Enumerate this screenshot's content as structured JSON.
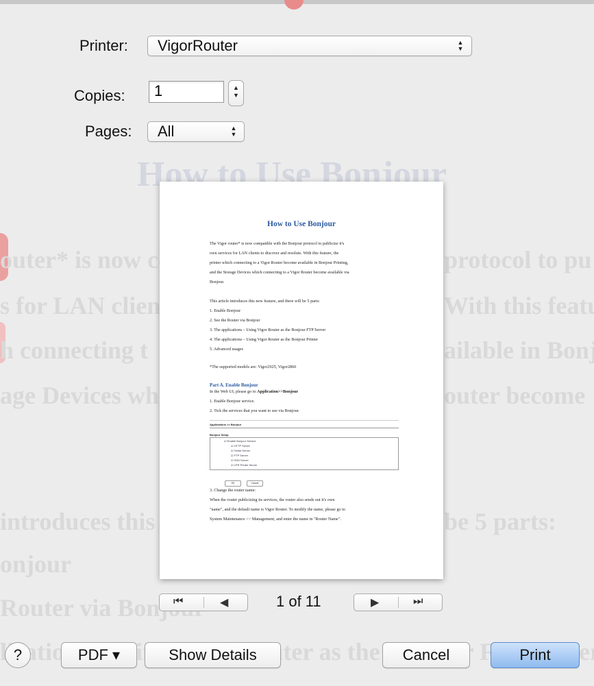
{
  "background_document": {
    "title": "How to Use Bonjour",
    "lines": [
      "outer* is now co",
      "protocol to pu",
      "s for LAN client",
      "With this featu",
      "h connecting t",
      "ailable in Bonj",
      "age Devices wh",
      "outer become",
      "introduces this",
      "be 5 parts:",
      "onjour",
      "Router via Bonjour",
      "lications - Using Vigor Router as the Bonjour FTP Server"
    ]
  },
  "printer": {
    "label": "Printer:",
    "value": "VigorRouter"
  },
  "copies": {
    "label": "Copies:",
    "value": "1"
  },
  "pages": {
    "label": "Pages:",
    "value": "All"
  },
  "preview": {
    "title": "How to Use Bonjour",
    "intro": [
      "The Vigor router* is now compatible with the Bonjour protocol to publicize it's",
      "own services for LAN clients to discover and resolute. With this feature, the",
      "printer which connecting to a Vigor Router become available in Bonjour Printing,",
      "and the Storage Devices which connecting to a Vigor Router become available via",
      "Bonjour."
    ],
    "parts_intro": "This article introduces this new feature, and there will be 5 parts:",
    "parts": [
      "1.   Enable Bonjour",
      "2.   See the Router via Bonjour",
      "3.   The applications – Using Vigor Router as the Bonjour FTP Server",
      "4.   The applications – Using Vigor Router as the Bonjour Printer",
      "5.   Advanced usages"
    ],
    "supported": "*The supported models are: Vigor2925, Vigor2860",
    "part_a_title": "Part A. Enable Bonjour",
    "part_a_lead": "In the Web UI, please go to ",
    "part_a_path": "Application>>Bonjour",
    "part_a_steps": [
      "1.   Enable Bonjour service.",
      "2.   Tick the services that you want to see via Bonjour."
    ],
    "screenshot": {
      "header": "Applications >> Bonjour",
      "section": "Bonjour Setup",
      "items": [
        "☑ Enable Bonjour Service",
        "☑ HTTP Server",
        "☑ Telnet Server",
        "☑ FTP Server",
        "☑ SSH Server",
        "☑ LPR Printer Server"
      ],
      "ok": "OK",
      "cancel": "Cancel"
    },
    "step3_title": "3. Change the router name:",
    "step3_lines": [
      "When the router publicizing its services, the router also sends out it's own",
      "\"name\", and the default name is Vigor Router. To modify the name, please go to",
      "System Maintenance >> Management, and enter the name in \"Router Name\"."
    ]
  },
  "pager": {
    "first_icon": "⏮",
    "prev_icon": "◀",
    "next_icon": "▶",
    "last_icon": "⏭",
    "indicator": "1 of 11"
  },
  "footer": {
    "help": "?",
    "pdf": "PDF ▾",
    "show_details": "Show Details",
    "cancel": "Cancel",
    "print": "Print"
  },
  "colors": {
    "accent": "#8fbbef",
    "preview_heading": "#2c5aa0"
  }
}
